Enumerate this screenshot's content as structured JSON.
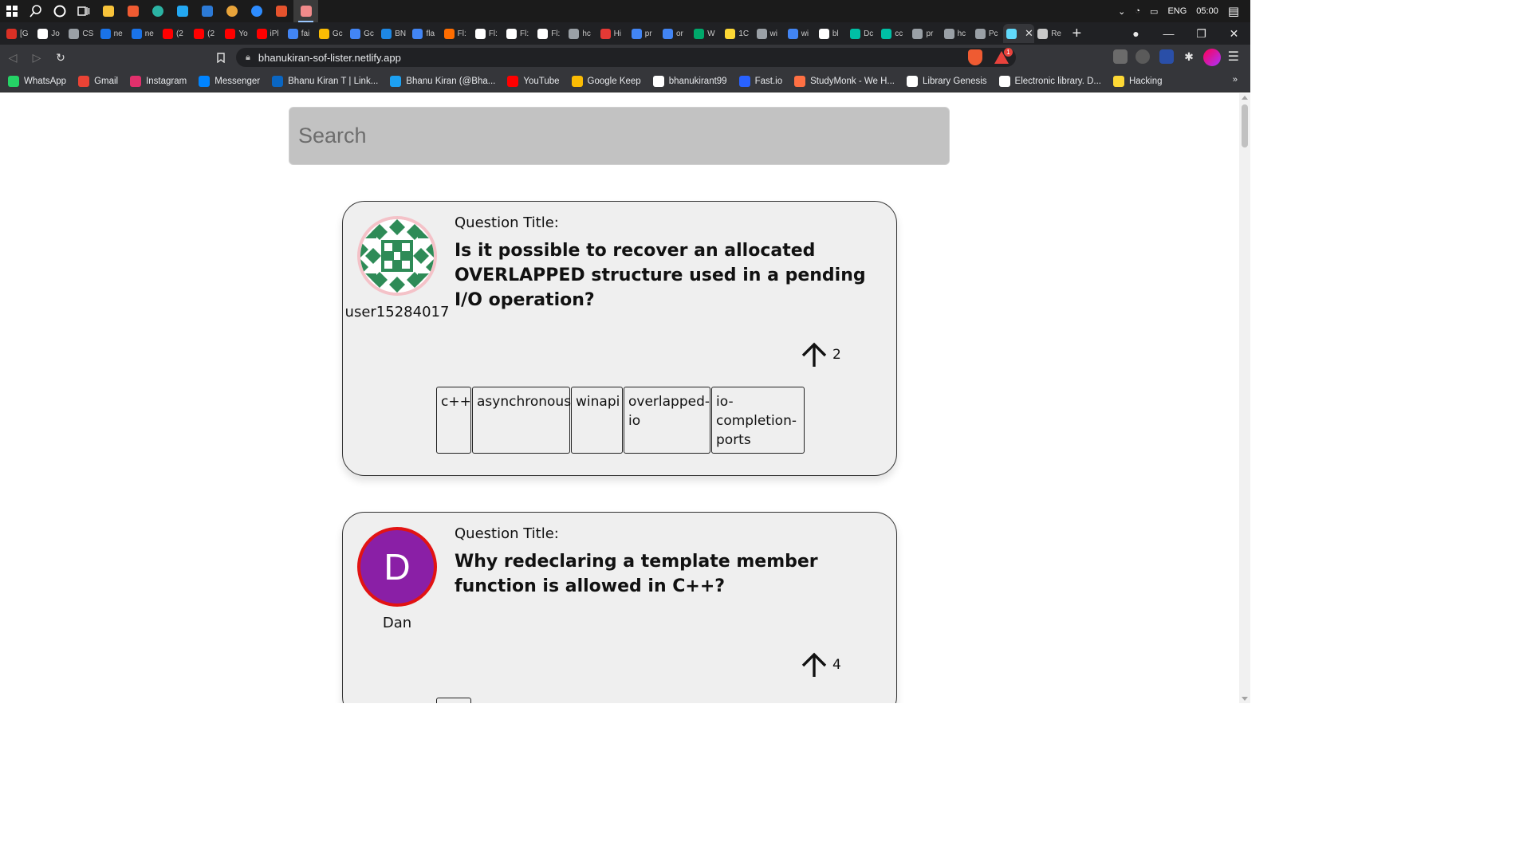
{
  "taskbar": {
    "tray": {
      "language": "ENG",
      "time": "05:00"
    }
  },
  "tabs": [
    {
      "label": "[G",
      "color": "#d93025"
    },
    {
      "label": "Jo",
      "color": "#ffffff"
    },
    {
      "label": "CS",
      "color": "#9aa0a6"
    },
    {
      "label": "ne",
      "color": "#1a73e8"
    },
    {
      "label": "ne",
      "color": "#1a73e8"
    },
    {
      "label": "(2",
      "color": "#ff0000"
    },
    {
      "label": "(2",
      "color": "#ff0000"
    },
    {
      "label": "Yo",
      "color": "#ff0000"
    },
    {
      "label": "iPl",
      "color": "#ff0000"
    },
    {
      "label": "fai",
      "color": "#4285f4"
    },
    {
      "label": "Gc",
      "color": "#fbbc04"
    },
    {
      "label": "Gc",
      "color": "#4285f4"
    },
    {
      "label": "BN",
      "color": "#1e88e5"
    },
    {
      "label": "fla",
      "color": "#4285f4"
    },
    {
      "label": "Fl:",
      "color": "#ff6d00"
    },
    {
      "label": "Fl:",
      "color": "#ffffff"
    },
    {
      "label": "Fl:",
      "color": "#ffffff"
    },
    {
      "label": "Fl:",
      "color": "#ffffff"
    },
    {
      "label": "hc",
      "color": "#9aa0a6"
    },
    {
      "label": "Hi",
      "color": "#e53935"
    },
    {
      "label": "pr",
      "color": "#4285f4"
    },
    {
      "label": "or",
      "color": "#4285f4"
    },
    {
      "label": "W",
      "color": "#00a86b"
    },
    {
      "label": "1C",
      "color": "#fdd835"
    },
    {
      "label": "wi",
      "color": "#9aa0a6"
    },
    {
      "label": "wi",
      "color": "#4285f4"
    },
    {
      "label": "bl",
      "color": "#ffffff"
    },
    {
      "label": "Dc",
      "color": "#00bfa5"
    },
    {
      "label": "cc",
      "color": "#00bfa5"
    },
    {
      "label": "pr",
      "color": "#9aa0a6"
    },
    {
      "label": "hc",
      "color": "#9aa0a6"
    },
    {
      "label": "Pc",
      "color": "#9aa0a6"
    },
    {
      "label": "",
      "color": "#61dafb",
      "active": true
    },
    {
      "label": "Re",
      "color": "#c9c9c9"
    }
  ],
  "browser": {
    "url": "bhanukiran-sof-lister.netlify.app",
    "brave_badge": "1"
  },
  "bookmarks": [
    {
      "label": "WhatsApp",
      "color": "#25d366"
    },
    {
      "label": "Gmail",
      "color": "#ea4335"
    },
    {
      "label": "Instagram",
      "color": "#e1306c"
    },
    {
      "label": "Messenger",
      "color": "#0084ff"
    },
    {
      "label": "Bhanu Kiran T | Link...",
      "color": "#0a66c2"
    },
    {
      "label": "Bhanu Kiran (@Bha...",
      "color": "#1da1f2"
    },
    {
      "label": "YouTube",
      "color": "#ff0000"
    },
    {
      "label": "Google Keep",
      "color": "#fbbc04"
    },
    {
      "label": "bhanukirant99",
      "color": "#ffffff"
    },
    {
      "label": "Fast.io",
      "color": "#2962ff"
    },
    {
      "label": "StudyMonk - We H...",
      "color": "#ff7043"
    },
    {
      "label": "Library Genesis",
      "color": "#ffffff"
    },
    {
      "label": "Electronic library. D...",
      "color": "#ffffff"
    },
    {
      "label": "Hacking",
      "color": "#fdd835"
    }
  ],
  "bookmarks_more": "»",
  "page": {
    "search": {
      "placeholder": "Search",
      "value": ""
    },
    "questions": [
      {
        "user": "user15284017",
        "title_label": "Question Title:",
        "title": "Is it possible to recover an allocated OVERLAPPED structure used in a pending I/O operation?",
        "votes": "2",
        "tags": [
          "c++",
          "asynchronous",
          "winapi",
          "overlapped-io",
          "io-completion-ports"
        ]
      },
      {
        "user": "Dan",
        "avatar_letter": "D",
        "title_label": "Question Title:",
        "title": "Why redeclaring a template member function is allowed in C++?",
        "votes": "4",
        "tags": []
      }
    ]
  },
  "colors": {
    "avatar1_border": "#f4c2c8",
    "avatar1_pattern": "#2e8b57",
    "avatar2_bg": "#8a1fa6",
    "avatar2_border": "#e21313",
    "card_bg": "#efefef",
    "search_bg": "#c2c2c2"
  }
}
